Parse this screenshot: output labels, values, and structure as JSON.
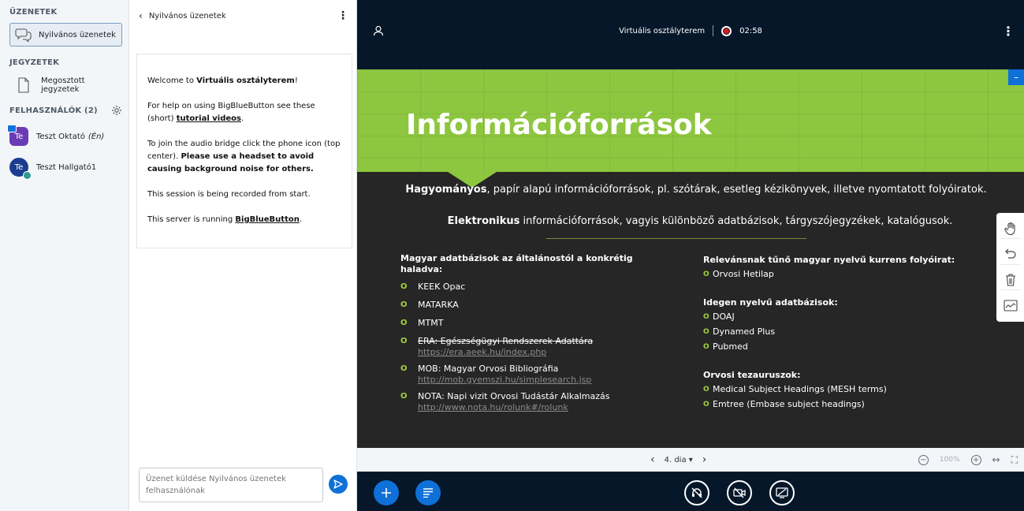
{
  "sidebar": {
    "messages_title": "ÜZENETEK",
    "public_chat_label": "Nyilvános üzenetek",
    "notes_title": "JEGYZETEK",
    "shared_notes_label": "Megosztott jegyzetek",
    "users_title": "FELHASZNÁLÓK (2)",
    "users": [
      {
        "initials": "Te",
        "name": "Teszt Oktató",
        "suffix": "(Én)",
        "color": "#6b3bb5"
      },
      {
        "initials": "Te",
        "name": "Teszt Hallgató1",
        "suffix": "",
        "color": "#1b3d8f"
      }
    ]
  },
  "chat": {
    "header_title": "Nyilvános üzenetek",
    "welcome": {
      "line1_prefix": "Welcome to ",
      "line1_bold": "Virtuális osztályterem",
      "line1_suffix": "!",
      "line2": "For help on using BigBlueButton see these (short) ",
      "line2_link": "tutorial videos",
      "line2_suffix": ".",
      "line3": "To join the audio bridge click the phone icon (top center). ",
      "line3_bold": "Please use a headset to avoid causing background noise for others.",
      "line4": "This session is being recorded from start.",
      "line5_prefix": "This server is running ",
      "line5_link": "BigBlueButton",
      "line5_suffix": "."
    },
    "input_placeholder": "Üzenet küldése Nyilvános üzenetek felhasználónak"
  },
  "topbar": {
    "title": "Virtuális osztályterem",
    "timer": "02:58"
  },
  "slide": {
    "title": "Információforrások",
    "intro1_bold": "Hagyományos",
    "intro1_rest": ", papír alapú információforrások, pl. szótárak, esetleg kézikönyvek, illetve nyomtatott folyóiratok.",
    "intro2_bold": "Elektronikus",
    "intro2_rest": " információforrások, vagyis különböző adatbázisok, tárgyszójegyzékek, katalógusok.",
    "left_heading": "Magyar adatbázisok az általánostól a konkrétig haladva:",
    "left_items": [
      {
        "text": "KEEK Opac",
        "link": ""
      },
      {
        "text": "MATARKA",
        "link": ""
      },
      {
        "text": "MTMT",
        "link": ""
      },
      {
        "text": "ERA: Egészségügyi Rendszerek Adattára",
        "link": "https://era.aeek.hu/index.php"
      },
      {
        "text": "MOB: Magyar Orvosi Bibliográfia",
        "link": "http://mob.gyemszi.hu/simplesearch.jsp"
      },
      {
        "text": "NOTA: Napi vizit Orvosi Tudástár Alkalmazás",
        "link": "http://www.nota.hu/rolunk#/rolunk"
      }
    ],
    "right_sections": [
      {
        "heading": "Relevánsnak tűnő magyar nyelvű kurrens folyóirat:",
        "items": [
          "Orvosi Hetilap"
        ]
      },
      {
        "heading": "Idegen nyelvű adatbázisok:",
        "items": [
          "DOAJ",
          "Dynamed Plus",
          "Pubmed"
        ]
      },
      {
        "heading": "Orvosi tezauruszok:",
        "items": [
          "Medical Subject Headings (MESH terms)",
          "Emtree (Embase subject headings)"
        ]
      }
    ],
    "minimize_label": "–"
  },
  "slide_nav": {
    "page_label": "4. dia",
    "zoom": "100%"
  },
  "colors": {
    "accent": "#0f70d7",
    "slide_green": "#8dc63f",
    "record_red": "#d21e1e"
  }
}
